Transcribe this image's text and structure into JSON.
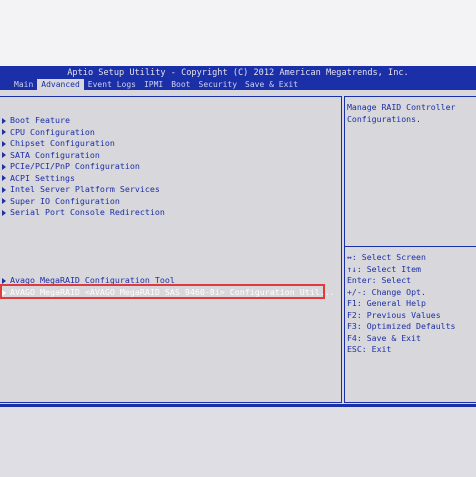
{
  "header": {
    "title": "Aptio Setup Utility - Copyright (C) 2012 American Megatrends, Inc."
  },
  "tabs": [
    {
      "label": "Main",
      "active": false
    },
    {
      "label": "Advanced",
      "active": true
    },
    {
      "label": "Event Logs",
      "active": false
    },
    {
      "label": "IPMI",
      "active": false
    },
    {
      "label": "Boot",
      "active": false
    },
    {
      "label": "Security",
      "active": false
    },
    {
      "label": "Save & Exit",
      "active": false
    }
  ],
  "menu": {
    "items": [
      "Boot Feature",
      "CPU Configuration",
      "Chipset Configuration",
      "SATA Configuration",
      "PCIe/PCI/PnP Configuration",
      "ACPI Settings",
      "Intel Server Platform Services",
      "Super IO Configuration",
      "Serial Port Console Redirection"
    ],
    "raid_items": [
      "Avago MegaRAID Configuration Tool",
      "AVAGO MegaRAID <AVAGO MegaRAID SAS 9460-8i> Configuration Util..."
    ]
  },
  "help": {
    "text": "Manage RAID Controller\nConfigurations."
  },
  "keys": [
    "↔: Select Screen",
    "↑↓: Select Item",
    "Enter: Select",
    "+/-: Change Opt.",
    "F1: General Help",
    "F2: Previous Values",
    "F3: Optimized Defaults",
    "F4: Save & Exit",
    "ESC: Exit"
  ],
  "colors": {
    "accent": "#1a2fa8",
    "background": "#d7d7dc",
    "highlight_box": "#e03a3a"
  }
}
